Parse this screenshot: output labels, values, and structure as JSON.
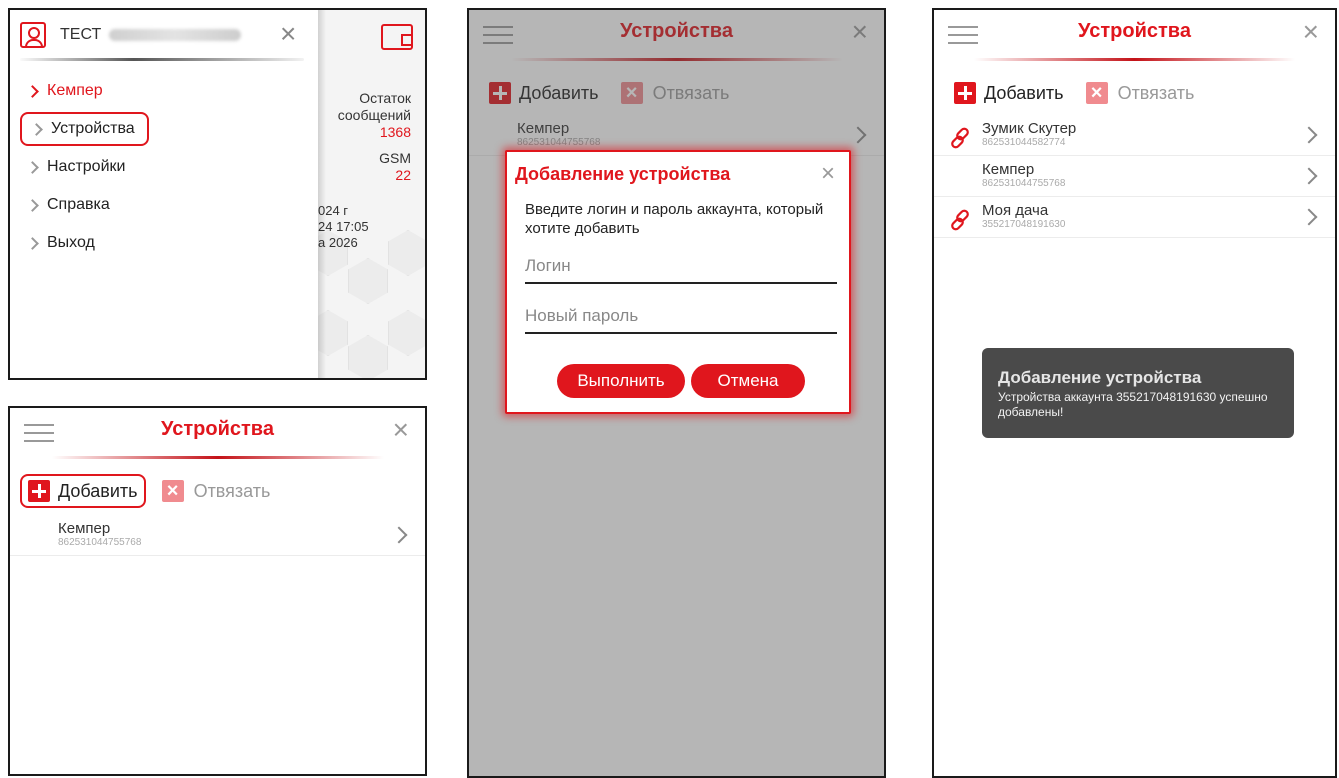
{
  "menu_screen": {
    "user_label": "ТЕСТ",
    "items": [
      {
        "label": "Кемпер"
      },
      {
        "label": "Устройства"
      },
      {
        "label": "Настройки"
      },
      {
        "label": "Справка"
      },
      {
        "label": "Выход"
      }
    ],
    "background": {
      "remaining_label_1": "Остаток",
      "remaining_label_2": "сообщений",
      "remaining_value": "1368",
      "gsm_label": "GSM",
      "gsm_value": "22",
      "date_1": "024 г",
      "date_2": "24 17:05",
      "date_3": "а 2026"
    }
  },
  "devices_screen": {
    "title": "Устройства",
    "add_label": "Добавить",
    "unbind_label": "Отвязать",
    "devices": [
      {
        "name": "Кемпер",
        "id": "862531044755768"
      }
    ]
  },
  "dialog_screen": {
    "title": "Устройства",
    "add_label": "Добавить",
    "unbind_label": "Отвязать",
    "devices": [
      {
        "name": "Кемпер",
        "id": "862531044755768"
      }
    ],
    "dialog": {
      "title": "Добавление устройства",
      "text": "Введите логин и пароль аккаунта, который хотите добавить",
      "login_placeholder": "Логин",
      "password_placeholder": "Новый пароль",
      "submit_label": "Выполнить",
      "cancel_label": "Отмена"
    }
  },
  "result_screen": {
    "title": "Устройства",
    "add_label": "Добавить",
    "unbind_label": "Отвязать",
    "devices": [
      {
        "name": "Зумик Скутер",
        "id": "862531044582774"
      },
      {
        "name": "Кемпер",
        "id": "862531044755768"
      },
      {
        "name": "Моя дача",
        "id": "355217048191630"
      }
    ],
    "toast": {
      "title": "Добавление устройства",
      "text": "Устройства аккаунта 355217048191630 успешно добавлены!"
    }
  },
  "colors": {
    "accent": "#e0161d",
    "toast_bg": "#4a4a4a"
  }
}
